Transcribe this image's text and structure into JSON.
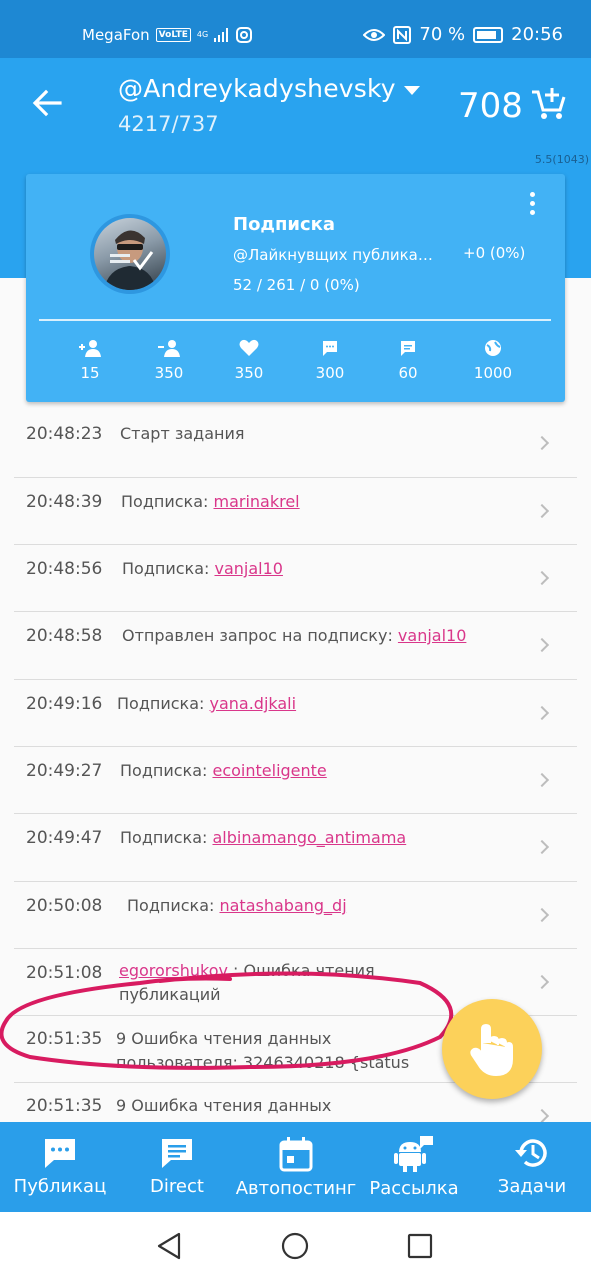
{
  "status_bar": {
    "carrier": "MegaFon",
    "volte": "VoLTE",
    "net": "4G",
    "battery": "70 %",
    "time": "20:56"
  },
  "header": {
    "account": "@Andreykadyshevsky",
    "stats": "4217/737",
    "points": "708",
    "version": "5.5(1043)"
  },
  "task_card": {
    "title": "Подписка",
    "target": "@Лайкнувщих публикаци...",
    "delta": "+0 (0%)",
    "progress": "52 / 261 / 0 (0%)",
    "stats": [
      {
        "icon": "add-user-icon",
        "value": "15"
      },
      {
        "icon": "remove-user-icon",
        "value": "350"
      },
      {
        "icon": "heart-icon",
        "value": "350"
      },
      {
        "icon": "comment-icon",
        "value": "300"
      },
      {
        "icon": "message-icon",
        "value": "60"
      },
      {
        "icon": "globe-icon",
        "value": "1000"
      }
    ]
  },
  "log": [
    {
      "time": "20:48:23",
      "prefix": "Старт задания",
      "link": "",
      "suffix": ""
    },
    {
      "time": "20:48:39",
      "prefix": "Подписка: ",
      "link": "marinakrel",
      "suffix": ""
    },
    {
      "time": "20:48:56",
      "prefix": "Подписка: ",
      "link": "vanjal10",
      "suffix": ""
    },
    {
      "time": "20:48:58",
      "prefix": "Отправлен запрос на подписку: ",
      "link": "vanjal10",
      "suffix": ""
    },
    {
      "time": "20:49:16",
      "prefix": "Подписка: ",
      "link": "yana.djkali",
      "suffix": ""
    },
    {
      "time": "20:49:27",
      "prefix": "Подписка: ",
      "link": "ecointeligente",
      "suffix": ""
    },
    {
      "time": "20:49:47",
      "prefix": "Подписка: ",
      "link": "albinamango_antimama",
      "suffix": ""
    },
    {
      "time": "20:50:08",
      "prefix": "Подписка: ",
      "link": "natashabang_dj",
      "suffix": ""
    },
    {
      "time": "20:51:08",
      "prefix": "",
      "link": "egororshukov",
      "suffix": " : Ошибка чтения",
      "line2": "публикаций"
    },
    {
      "time": "20:51:35",
      "prefix": "9 Ошибка чтения данных",
      "link": "",
      "suffix": "",
      "line2": "пользователя: 3246340218 {status"
    },
    {
      "time": "20:51:35",
      "prefix": "9 Ошибка чтения данных",
      "link": "",
      "suffix": ""
    }
  ],
  "bottom_nav": [
    {
      "label": "Публикац",
      "icon": "publications-icon"
    },
    {
      "label": "Direct",
      "icon": "direct-icon"
    },
    {
      "label": "Автопостинг",
      "icon": "calendar-icon"
    },
    {
      "label": "Рассылка",
      "icon": "android-icon"
    },
    {
      "label": "Задачи",
      "icon": "history-icon"
    }
  ],
  "colors": {
    "primary": "#29a3ef",
    "card": "#42b2f5",
    "link": "#d9368a",
    "fab": "#fcd15a",
    "annotation": "#d81b60"
  }
}
